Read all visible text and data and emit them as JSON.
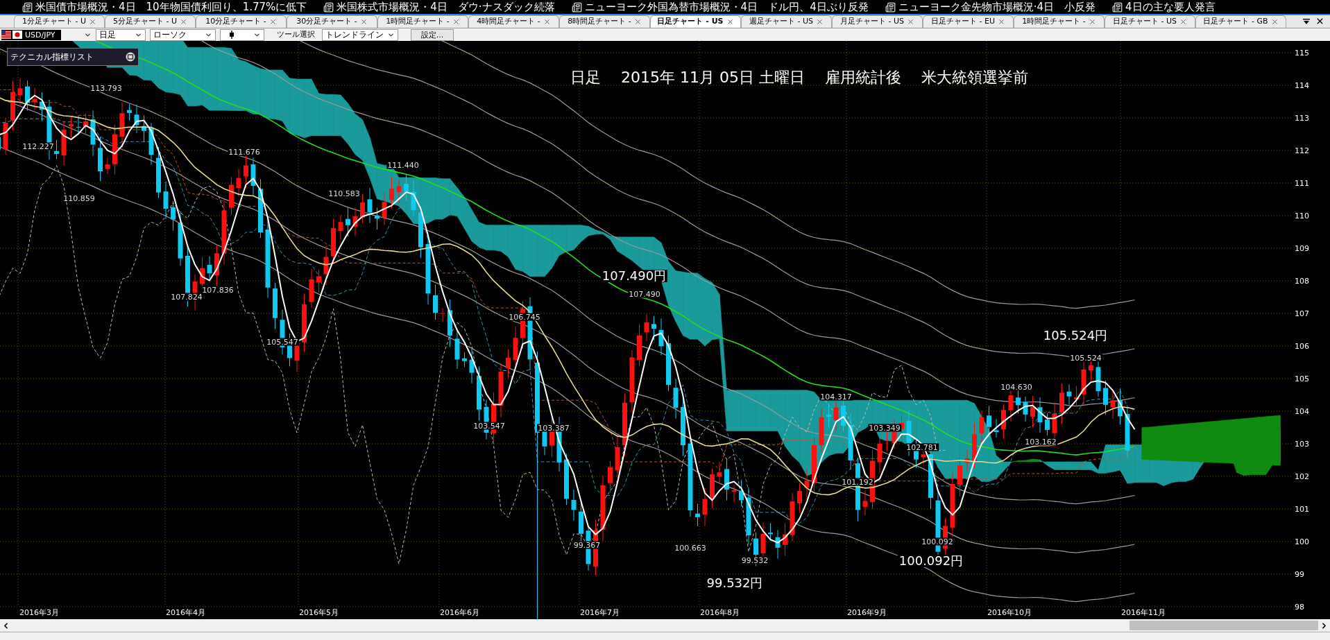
{
  "news_ticker": [
    "米国債市場概況・4日　10年物国債利回り、1.77%に低下",
    "米国株式市場概況・4日　ダウ·ナスダック続落",
    "ニューヨーク外国為替市場概況・4日　ドル円、4日ぶり反発",
    "ニューヨーク金先物市場概況·4日　小反発",
    "4日の主な要人発言"
  ],
  "tabs": [
    {
      "label": "1分足チャート - U",
      "selected": false
    },
    {
      "label": "5分足チャート - U",
      "selected": false
    },
    {
      "label": "10分足チャート -",
      "selected": false
    },
    {
      "label": "30分足チャート -",
      "selected": false
    },
    {
      "label": "1時間足チャート -",
      "selected": false
    },
    {
      "label": "4時間足チャート -",
      "selected": false
    },
    {
      "label": "8時間足チャート -",
      "selected": false
    },
    {
      "label": "日足チャート - US",
      "selected": true
    },
    {
      "label": "週足チャート - US",
      "selected": false
    },
    {
      "label": "月足チャート - US",
      "selected": false
    },
    {
      "label": "日足チャート - EU",
      "selected": false
    },
    {
      "label": "1時間足チャート -",
      "selected": false
    },
    {
      "label": "日足チャート - US",
      "selected": false
    },
    {
      "label": "日足チャート - GB",
      "selected": false
    }
  ],
  "toolbar": {
    "symbol": "USD/JPY",
    "timeframe": "日足",
    "chart_type": "ローソク",
    "tool_label": "ツール選択",
    "tool": "トレンドライン",
    "settings_button": "設定..."
  },
  "indicator_panel": {
    "title": "テクニカル指標リスト"
  },
  "chart": {
    "title": "日足　 2015年 11月 05日 土曜日　 雇用統計後　 米大統領選挙前",
    "callouts": [
      "107.490円",
      "105.524円",
      "99.532円",
      "100.092円"
    ],
    "price_labels": [
      "113.793",
      "112.227",
      "110.859",
      "107.824",
      "107.836",
      "111.676",
      "105.547",
      "110.583",
      "111.440",
      "106.745",
      "103.547",
      "103.387",
      "99.367",
      "107.490",
      "100.663",
      "99.532",
      "104.317",
      "103.349",
      "102.781",
      "101.192",
      "100.092",
      "104.630",
      "103.162",
      "105.524"
    ],
    "y_axis": [
      "115",
      "114",
      "113",
      "112",
      "111",
      "110",
      "109",
      "108",
      "107",
      "106",
      "105",
      "104",
      "103",
      "102",
      "101",
      "100",
      "99",
      "98"
    ],
    "x_axis": [
      "2016年3月",
      "2016年4月",
      "2016年5月",
      "2016年6月",
      "2016年7月",
      "2016年8月",
      "2016年9月",
      "2016年10月",
      "2016年11月"
    ]
  }
}
